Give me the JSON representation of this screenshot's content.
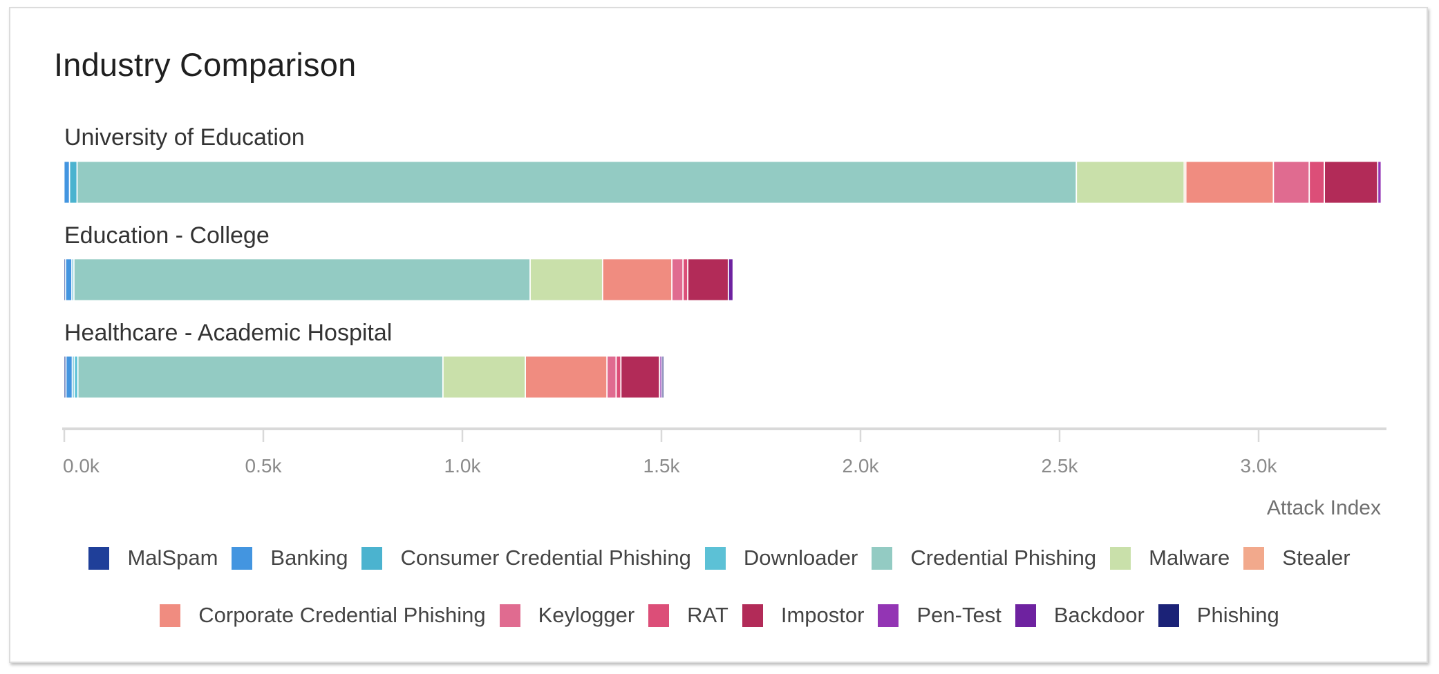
{
  "card": {
    "title": "Industry Comparison"
  },
  "chart_data": {
    "type": "bar",
    "orientation": "horizontal",
    "stacked": true,
    "title": "Industry Comparison",
    "xlabel": "Attack Index",
    "ylabel": "",
    "xlim": [
      0,
      3320
    ],
    "x_ticks": [
      0,
      500,
      1000,
      1500,
      2000,
      2500,
      3000
    ],
    "x_tick_labels": [
      "0.0k",
      "0.5k",
      "1.0k",
      "1.5k",
      "2.0k",
      "2.5k",
      "3.0k"
    ],
    "grid": false,
    "legend_position": "bottom",
    "categories": [
      "University of Education",
      "Education - College",
      "Healthcare - Academic Hospital"
    ],
    "series": [
      {
        "name": "MalSpam",
        "color": "#1f3f99",
        "values": [
          0,
          4,
          5
        ]
      },
      {
        "name": "Banking",
        "color": "#4395e0",
        "values": [
          14,
          16,
          16
        ]
      },
      {
        "name": "Consumer Credential Phishing",
        "color": "#4bb3cf",
        "values": [
          19,
          5,
          5
        ]
      },
      {
        "name": "Downloader",
        "color": "#5cc1d6",
        "values": [
          0,
          0,
          9
        ]
      },
      {
        "name": "Credential Phishing",
        "color": "#93cbc3",
        "values": [
          2510,
          1146,
          917
        ]
      },
      {
        "name": "Malware",
        "color": "#c9e0aa",
        "values": [
          271,
          182,
          207
        ]
      },
      {
        "name": "Stealer",
        "color": "#f2a98c",
        "values": [
          4,
          0,
          0
        ]
      },
      {
        "name": "Corporate Credential Phishing",
        "color": "#f08c80",
        "values": [
          220,
          174,
          205
        ]
      },
      {
        "name": "Keylogger",
        "color": "#e06b90",
        "values": [
          90,
          28,
          23
        ]
      },
      {
        "name": "RAT",
        "color": "#dc4e78",
        "values": [
          38,
          12,
          12
        ]
      },
      {
        "name": "Impostor",
        "color": "#b22b58",
        "values": [
          134,
          102,
          97
        ]
      },
      {
        "name": "Pen-Test",
        "color": "#9335b4",
        "values": [
          9,
          0,
          3
        ]
      },
      {
        "name": "Backdoor",
        "color": "#6e22a0",
        "values": [
          0,
          12,
          3
        ]
      },
      {
        "name": "Phishing",
        "color": "#1b2277",
        "values": [
          0,
          0,
          5
        ]
      }
    ]
  },
  "legend": {
    "row1": [
      0,
      1,
      2,
      3,
      4,
      5,
      6
    ],
    "row2": [
      7,
      8,
      9,
      10,
      11,
      12,
      13
    ]
  }
}
